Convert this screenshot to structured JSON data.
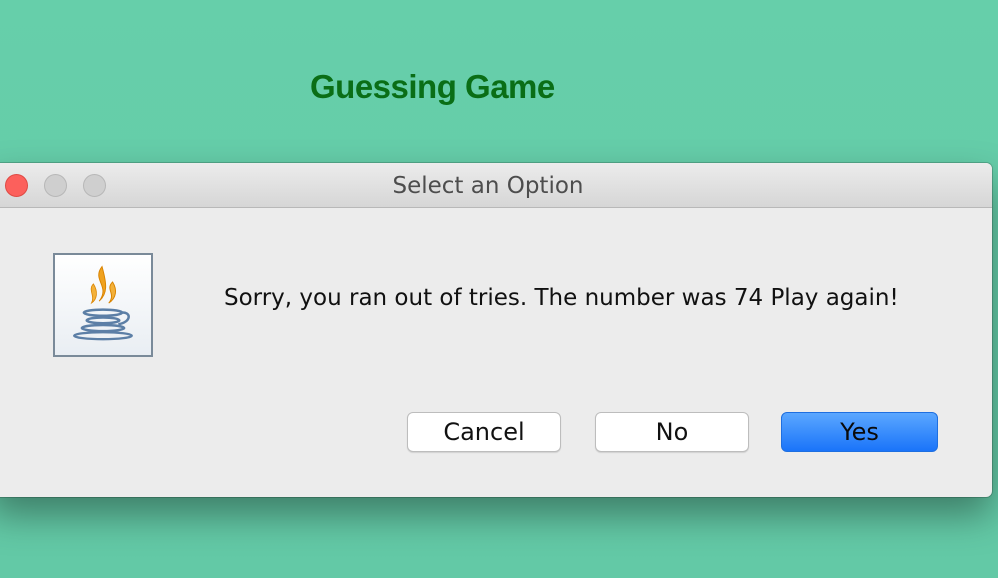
{
  "app": {
    "title": "Guessing Game",
    "background_color": "#66cfaa",
    "title_color": "#0a6e16"
  },
  "dialog": {
    "title": "Select an Option",
    "icon": "java-coffee-cup-icon",
    "message": "Sorry, you ran out of tries. The number was 74 Play again!",
    "buttons": {
      "cancel": "Cancel",
      "no": "No",
      "yes": "Yes"
    },
    "default_button_color": "#1a74f9"
  }
}
